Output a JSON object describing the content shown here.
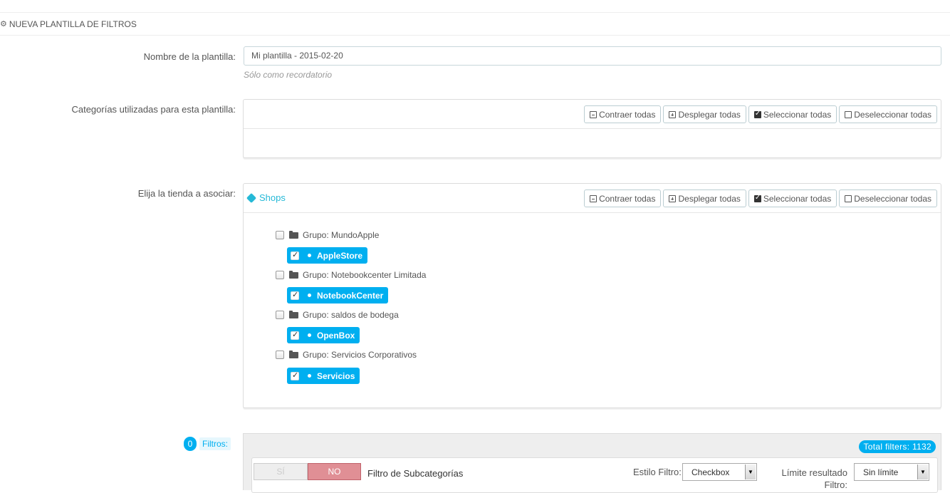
{
  "heading": {
    "icon": "cogs-icon",
    "title": "NUEVA PLANTILLA DE FILTROS"
  },
  "template_name": {
    "label": "Nombre de la plantilla:",
    "value": "Mi plantilla - 2015-02-20",
    "help": "Sólo como recordatorio"
  },
  "categories": {
    "label": "Categorías utilizadas para esta plantilla:",
    "buttons": {
      "collapse": "Contraer todas",
      "expand": "Desplegar todas",
      "select": "Seleccionar todas",
      "deselect": "Deseleccionar todas"
    }
  },
  "shops": {
    "label": "Elija la tienda a asociar:",
    "title": "Shops",
    "buttons": {
      "collapse": "Contraer todas",
      "expand": "Desplegar todas",
      "select": "Seleccionar todas",
      "deselect": "Deseleccionar todas"
    },
    "groups": [
      {
        "name": "Grupo: MundoApple",
        "checked": false,
        "shop": "AppleStore",
        "shop_checked": true
      },
      {
        "name": "Grupo: Notebookcenter Limitada",
        "checked": false,
        "shop": "NotebookCenter",
        "shop_checked": true
      },
      {
        "name": "Grupo: saldos de bodega",
        "checked": false,
        "shop": "OpenBox",
        "shop_checked": true
      },
      {
        "name": "Grupo: Servicios Corporativos",
        "checked": false,
        "shop": "Servicios",
        "shop_checked": true
      }
    ]
  },
  "filters": {
    "count": "0",
    "label": "Filtros:",
    "total": "Total filters: 1132",
    "row": {
      "toggle_yes": "SÍ",
      "toggle_no": "NO",
      "name": "Filtro de Subcategorías",
      "style_label": "Estilo Filtro:",
      "style_value": "Checkbox",
      "limit_label": "Límite resultado Filtro:",
      "limit_value": "Sin límite"
    }
  },
  "colors": {
    "accent": "#00aff0",
    "no_toggle": "#e08f95"
  }
}
